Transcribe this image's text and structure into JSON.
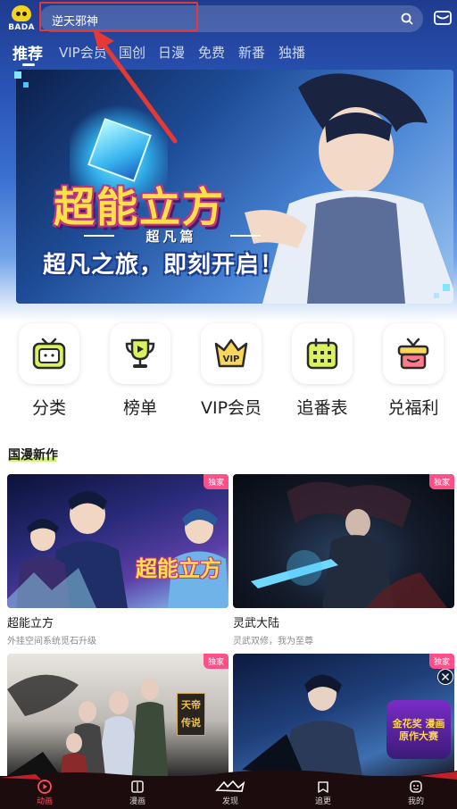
{
  "app": {
    "logo_text": "BADA"
  },
  "search": {
    "query": "逆天邪神"
  },
  "tabs": [
    "推荐",
    "VIP会员",
    "国创",
    "日漫",
    "免费",
    "新番",
    "独播"
  ],
  "banner": {
    "title": "超能立方",
    "subtitle": "超凡篇",
    "slogan": "超凡之旅，即刻开启！"
  },
  "shortcuts": [
    {
      "label": "分类",
      "icon": "tv-icon"
    },
    {
      "label": "榜单",
      "icon": "trophy-icon"
    },
    {
      "label": "VIP会员",
      "icon": "vip-crown-icon"
    },
    {
      "label": "追番表",
      "icon": "calendar-icon"
    },
    {
      "label": "兑福利",
      "icon": "gift-icon"
    }
  ],
  "section": {
    "title": "国漫新作"
  },
  "cards": [
    {
      "title": "超能立方",
      "desc": "外挂空间系统觅石升级",
      "badge": "独家",
      "overlay_text": "超能立方"
    },
    {
      "title": "灵武大陆",
      "desc": "灵武双修，我为至尊",
      "badge": "独家"
    },
    {
      "title": "",
      "desc": "",
      "badge": "独家",
      "overlay_text": "天帝传说"
    },
    {
      "title": "",
      "desc": "",
      "badge": "独家",
      "overlay_text": "金花奖 漫画原作大赛"
    }
  ],
  "bottom_nav": [
    {
      "label": "动画",
      "icon": "play-icon",
      "active": true
    },
    {
      "label": "漫画",
      "icon": "book-icon",
      "active": false
    },
    {
      "label": "发现",
      "icon": "discover-logo",
      "active": false
    },
    {
      "label": "追更",
      "icon": "follow-icon",
      "active": false
    },
    {
      "label": "我的",
      "icon": "profile-icon",
      "active": false
    }
  ],
  "colors": {
    "accent": "#ff4f87",
    "annotation": "#e53935",
    "nav_bg": "#1c0c0e"
  }
}
